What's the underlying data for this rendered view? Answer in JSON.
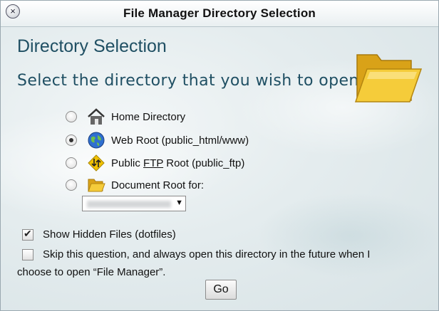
{
  "window": {
    "title": "File Manager Directory Selection"
  },
  "heading": "Directory Selection",
  "subheading": "Select the directory that you wish to open:",
  "options": [
    {
      "label": "Home Directory",
      "icon": "home-icon",
      "checked": false
    },
    {
      "label": "Web Root (public_html/www)",
      "icon": "globe-icon",
      "checked": true
    },
    {
      "label_pre": "Public ",
      "label_abbr": "FTP",
      "label_post": " Root (public_ftp)",
      "icon": "ftp-arrows-icon",
      "checked": false
    },
    {
      "label": "Document Root for:",
      "icon": "open-folder-icon",
      "checked": false
    }
  ],
  "domain_select": {
    "value": ""
  },
  "show_hidden": {
    "label": "Show Hidden Files (dotfiles)",
    "checked": true
  },
  "skip_question": {
    "line1": "Skip this question, and always open this directory in the future when I",
    "line2": "choose to open “File Manager”.",
    "checked": false
  },
  "go_button": "Go",
  "colors": {
    "heading": "#1f4f63",
    "folder": "#f2c230"
  }
}
